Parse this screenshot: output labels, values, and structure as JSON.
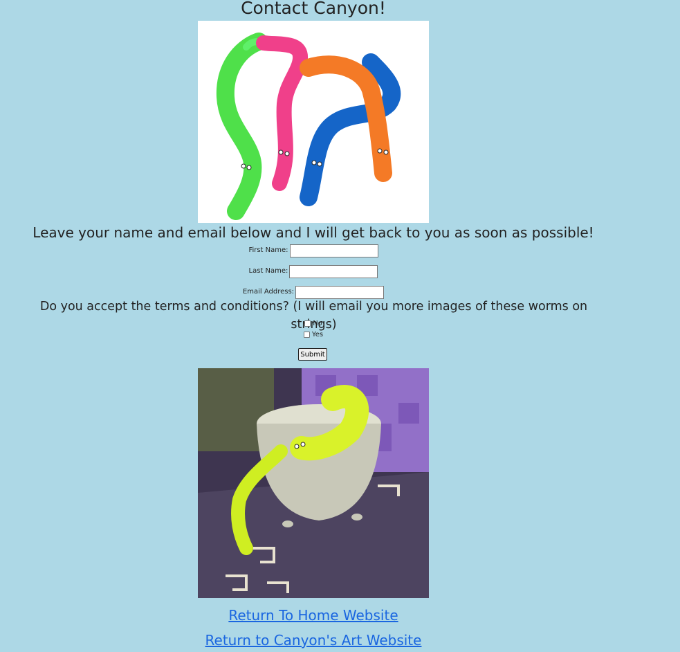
{
  "page": {
    "title": "Contact Canyon!",
    "intro": "Leave your name and email below and I will get back to you as soon as possible!"
  },
  "form": {
    "first_name_label": "First Name:",
    "last_name_label": "Last Name:",
    "email_label": "Email Address:",
    "first_name_value": "",
    "last_name_value": "",
    "email_value": "",
    "terms_question": "Do you accept the terms and conditions? (I will email you more images of these worms on strings)",
    "option_no": "No",
    "option_yes": "Yes",
    "submit_label": "Submit"
  },
  "links": {
    "home": "Return To Home Website",
    "art": "Return to Canyon's Art Website"
  },
  "colors": {
    "background": "#add8e6",
    "link": "#1a66e0"
  }
}
